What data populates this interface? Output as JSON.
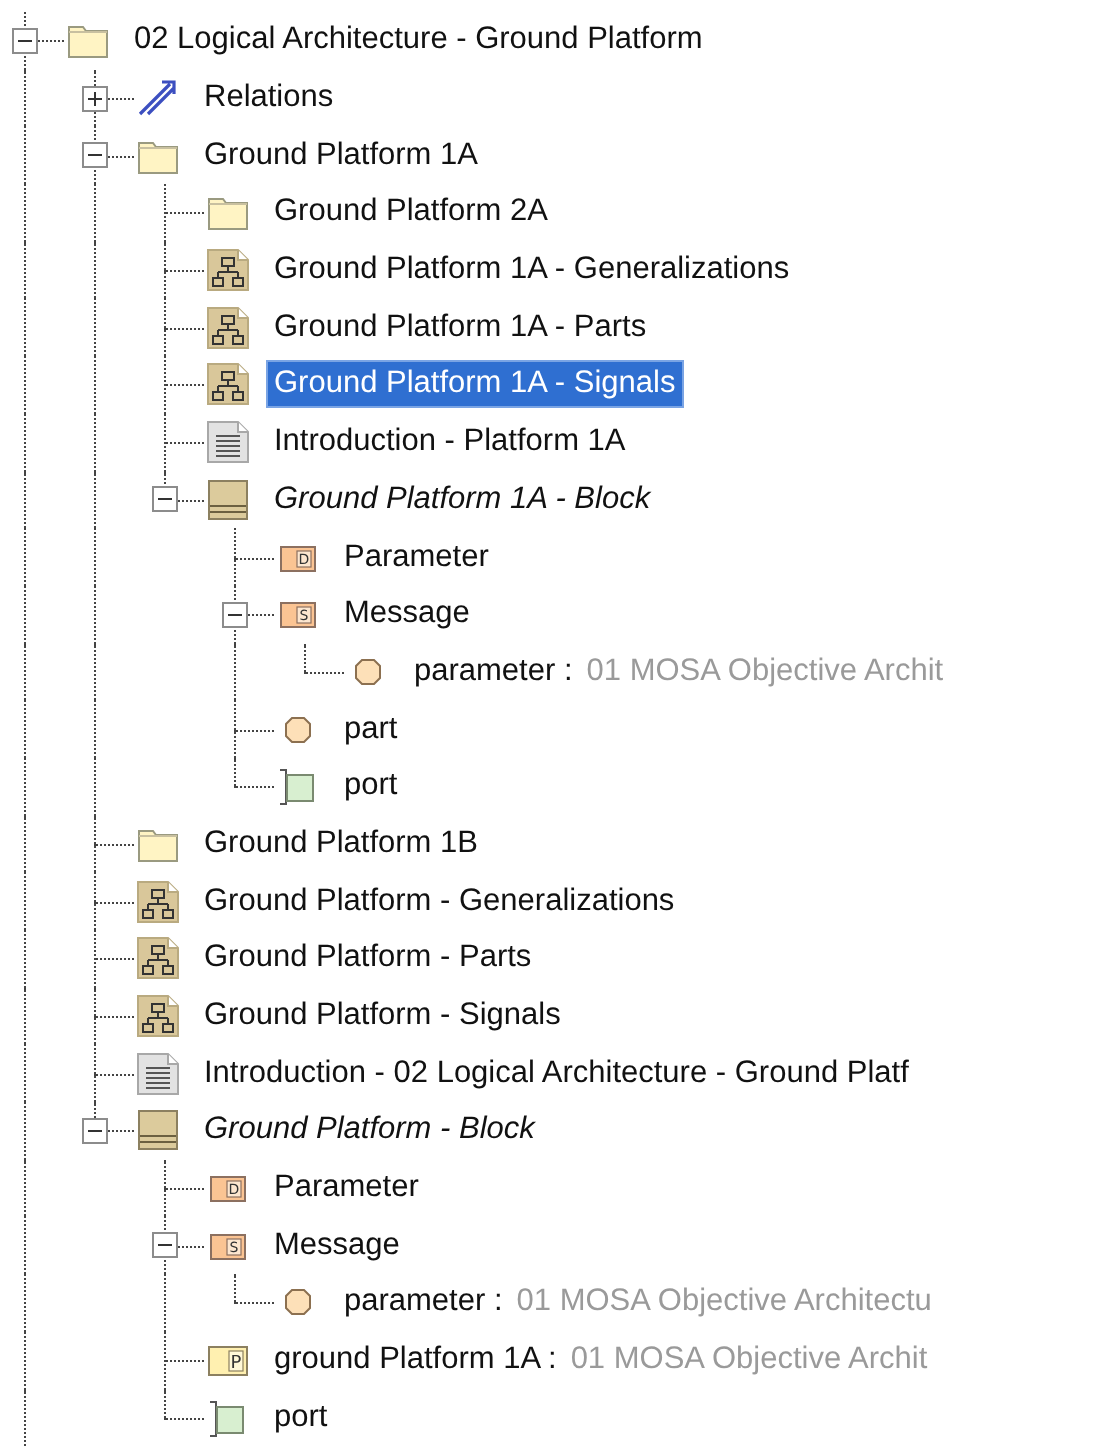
{
  "tree": [
    {
      "kind": "folder",
      "label": "02 Logical Architecture - Ground Platform",
      "selected": false,
      "expanded": true,
      "children": [
        {
          "kind": "relations",
          "label": "Relations",
          "selected": false,
          "expanded": false
        },
        {
          "kind": "folder",
          "label": "Ground Platform 1A",
          "selected": false,
          "expanded": true,
          "children": [
            {
              "kind": "folder",
              "label": "Ground Platform 2A",
              "selected": false
            },
            {
              "kind": "diagram",
              "label": "Ground Platform 1A - Generalizations",
              "selected": false
            },
            {
              "kind": "diagram",
              "label": "Ground Platform 1A - Parts",
              "selected": false
            },
            {
              "kind": "diagram",
              "label": "Ground Platform 1A - Signals",
              "selected": true
            },
            {
              "kind": "document",
              "label": "Introduction - Platform 1A",
              "selected": false
            },
            {
              "kind": "block",
              "label": "Ground Platform 1A - Block",
              "selected": false,
              "expanded": true,
              "children": [
                {
                  "kind": "value-type",
                  "badge": "D",
                  "label": "Parameter",
                  "selected": false
                },
                {
                  "kind": "signal",
                  "badge": "S",
                  "label": "Message",
                  "selected": false,
                  "expanded": true,
                  "children": [
                    {
                      "kind": "property",
                      "label": "parameter :",
                      "type": "01 MOSA Objective Archit",
                      "selected": false
                    }
                  ]
                },
                {
                  "kind": "property",
                  "label": "part",
                  "selected": false
                },
                {
                  "kind": "port",
                  "label": "port",
                  "selected": false
                }
              ]
            }
          ]
        },
        {
          "kind": "folder",
          "label": "Ground Platform 1B",
          "selected": false
        },
        {
          "kind": "diagram",
          "label": "Ground Platform - Generalizations",
          "selected": false
        },
        {
          "kind": "diagram",
          "label": "Ground Platform - Parts",
          "selected": false
        },
        {
          "kind": "diagram",
          "label": "Ground Platform - Signals",
          "selected": false
        },
        {
          "kind": "document",
          "label": "Introduction - 02 Logical Architecture - Ground Platf",
          "selected": false
        },
        {
          "kind": "block",
          "label": "Ground Platform - Block",
          "selected": false,
          "expanded": true,
          "children": [
            {
              "kind": "value-type",
              "badge": "D",
              "label": "Parameter",
              "selected": false
            },
            {
              "kind": "signal",
              "badge": "S",
              "label": "Message",
              "selected": false,
              "expanded": true,
              "children": [
                {
                  "kind": "property",
                  "label": "parameter :",
                  "type": "01 MOSA Objective Architectu",
                  "selected": false
                }
              ]
            },
            {
              "kind": "part-property",
              "badge": "P",
              "label": "ground Platform 1A :",
              "type": "01 MOSA Objective Archit",
              "selected": false
            },
            {
              "kind": "port",
              "label": "port",
              "selected": false
            }
          ]
        }
      ]
    }
  ]
}
